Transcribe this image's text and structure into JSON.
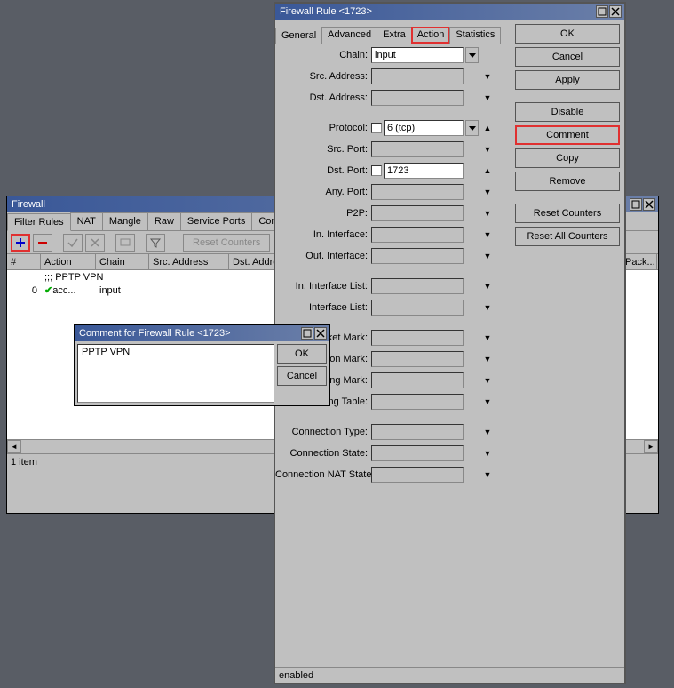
{
  "firewall": {
    "title": "Firewall",
    "tabs": [
      "Filter Rules",
      "NAT",
      "Mangle",
      "Raw",
      "Service Ports",
      "Connections"
    ],
    "toolbar": {
      "reset_counters": "Reset Counters",
      "more": "00"
    },
    "grid_headers": [
      "#",
      "Action",
      "Chain",
      "Src. Address",
      "Dst. Address",
      "Pack..."
    ],
    "comment_row": ";;; PPTP VPN",
    "row1": {
      "num": "0",
      "action": "acc...",
      "chain": "input"
    },
    "status": "1 item"
  },
  "rule": {
    "title": "Firewall Rule <1723>",
    "tabs": [
      "General",
      "Advanced",
      "Extra",
      "Action",
      "Statistics"
    ],
    "buttons": {
      "ok": "OK",
      "cancel": "Cancel",
      "apply": "Apply",
      "disable": "Disable",
      "comment": "Comment",
      "copy": "Copy",
      "remove": "Remove",
      "reset_counters": "Reset Counters",
      "reset_all_counters": "Reset All Counters"
    },
    "fields": {
      "chain": {
        "label": "Chain:",
        "value": "input"
      },
      "src_addr": {
        "label": "Src. Address:"
      },
      "dst_addr": {
        "label": "Dst. Address:"
      },
      "protocol": {
        "label": "Protocol:",
        "value": "6 (tcp)"
      },
      "src_port": {
        "label": "Src. Port:"
      },
      "dst_port": {
        "label": "Dst. Port:",
        "value": "1723"
      },
      "any_port": {
        "label": "Any. Port:"
      },
      "p2p": {
        "label": "P2P:"
      },
      "in_iface": {
        "label": "In. Interface:"
      },
      "out_iface": {
        "label": "Out. Interface:"
      },
      "in_iface_list": {
        "label": "In. Interface List:"
      },
      "out_iface_list": {
        "label": "Interface List:"
      },
      "packet_mark": {
        "label": "Packet Mark:"
      },
      "conn_mark": {
        "label": "nection Mark:"
      },
      "routing_mark": {
        "label": "Routing Mark:"
      },
      "routing_table": {
        "label": "Routing Table:"
      },
      "conn_type": {
        "label": "Connection Type:"
      },
      "conn_state": {
        "label": "Connection State:"
      },
      "conn_nat_state": {
        "label": "Connection NAT State:"
      }
    },
    "status": "enabled"
  },
  "comment": {
    "title": "Comment for Firewall Rule <1723>",
    "text": "PPTP VPN",
    "ok": "OK",
    "cancel": "Cancel"
  }
}
